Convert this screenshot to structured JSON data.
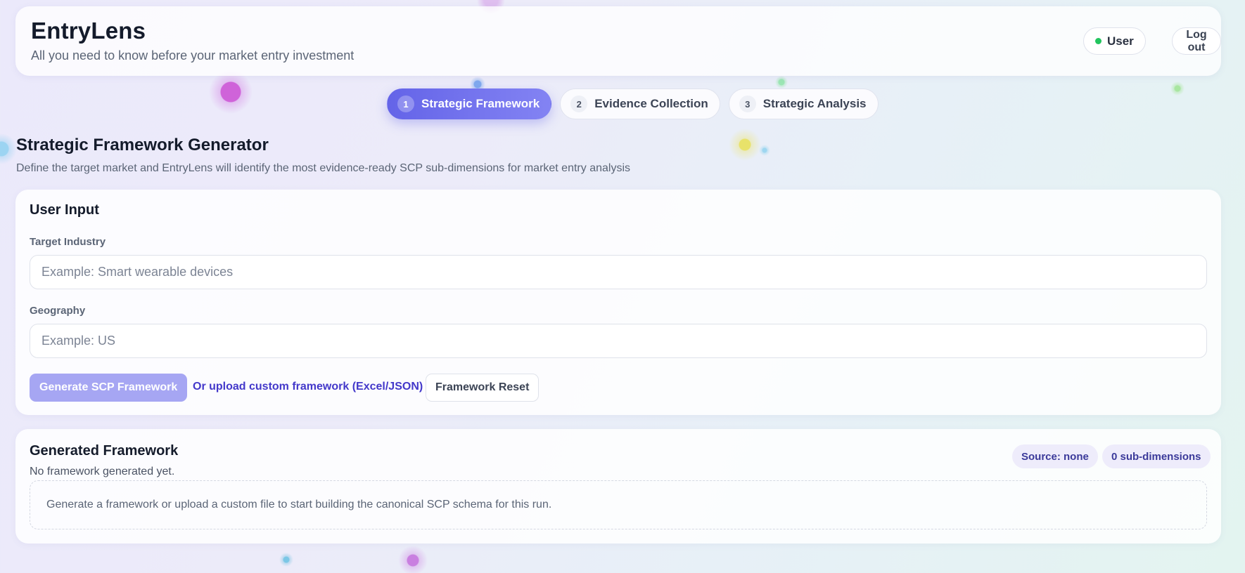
{
  "app": {
    "title": "EntryLens",
    "subtitle": "All you need to know before your market entry investment"
  },
  "user": {
    "label": "User",
    "status_color": "#22c55e"
  },
  "logout_label": "Log out",
  "steps": [
    {
      "num": "1",
      "label": "Strategic Framework",
      "active": true
    },
    {
      "num": "2",
      "label": "Evidence Collection",
      "active": false
    },
    {
      "num": "3",
      "label": "Strategic Analysis",
      "active": false
    }
  ],
  "page": {
    "title": "Strategic Framework Generator",
    "description": "Define the target market and EntryLens will identify the most evidence-ready SCP sub-dimensions for market entry analysis"
  },
  "input_card": {
    "title": "User Input",
    "industry": {
      "label": "Target Industry",
      "value": "",
      "placeholder": "Example: Smart wearable devices"
    },
    "geography": {
      "label": "Geography",
      "value": "",
      "placeholder": "Example: US"
    },
    "generate_label": "Generate SCP Framework",
    "upload_label": "Or upload custom framework (Excel/JSON)",
    "reset_label": "Framework Reset"
  },
  "output_card": {
    "title": "Generated Framework",
    "status": "No framework generated yet.",
    "source_badge": "Source: none",
    "count_badge": "0 sub-dimensions",
    "empty_message": "Generate a framework or upload a custom file to start building the canonical SCP schema for this run."
  },
  "colors": {
    "accent": "#6464e8",
    "link": "#4338ca",
    "generate_disabled": "#a6a6f3"
  }
}
